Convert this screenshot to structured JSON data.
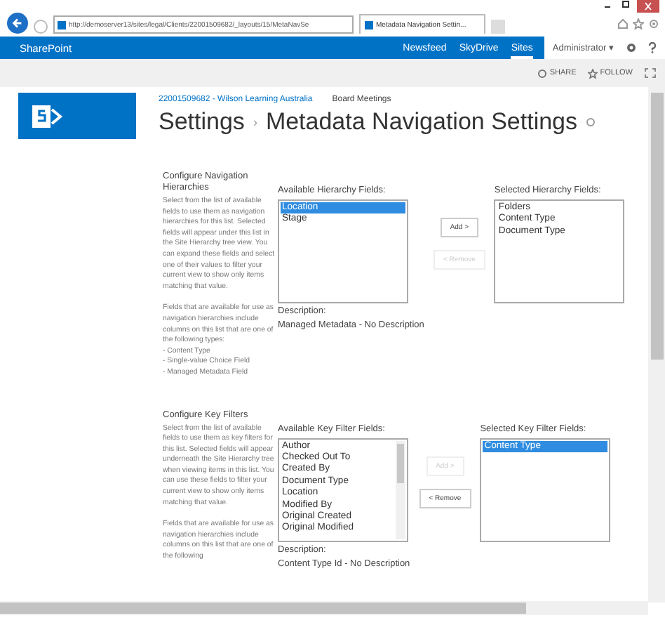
{
  "browser": {
    "address": "http://demoserver13/sites/legal/Clients/22001509682/_layouts/15/MetaNavSe",
    "tab": {
      "title": "Metadata Navigation Settin...",
      "selected": true
    }
  },
  "suite_bar": {
    "brand": "SharePoint",
    "links": [
      {
        "label": "Newsfeed",
        "selected": false
      },
      {
        "label": "SkyDrive",
        "selected": false
      },
      {
        "label": "Sites",
        "selected": true
      }
    ],
    "user": "Administrator",
    "user_caret": "▾"
  },
  "actions": [
    "SHARE",
    "FOLLOW"
  ],
  "breadcrumb": {
    "site": "22001509682 - Wilson Learning Australia",
    "subsite": "Board Meetings"
  },
  "title": {
    "parent": "Settings",
    "separator": "›",
    "page": "Metadata Navigation Settings"
  },
  "sections": [
    {
      "heading": "Configure Navigation Hierarchies",
      "paragraphs": [
        "Select from the list of available fields to use them as navigation hierarchies for this list.  Selected fields will appear under this list in the Site Hierarchy tree view.  You can expand these fields and select one of their values to filter your current view to show only items matching that value.",
        "Fields that are available for use as navigation hierarchies include columns on this list that are one of the following types:\n- Content Type\n- Single-value Choice Field\n- Managed Metadata Field"
      ],
      "available_label": "Available Hierarchy Fields:",
      "available": [
        {
          "label": "Location",
          "selected": true
        },
        {
          "label": "Stage",
          "selected": false
        }
      ],
      "available_scrollbar": false,
      "add": {
        "label": "Add >",
        "disabled": false
      },
      "remove": {
        "label": "< Remove",
        "disabled": true
      },
      "selected_label": "Selected Hierarchy Fields:",
      "chosen": [
        {
          "label": "Folders",
          "selected": false
        },
        {
          "label": "Content Type",
          "selected": false
        },
        {
          "label": "Document Type",
          "selected": false
        }
      ],
      "description_label": "Description:",
      "description": "Managed Metadata - No Description"
    },
    {
      "heading": "Configure Key Filters",
      "paragraphs": [
        "Select from the list of available fields to use them as key filters for this list.  Selected fields will appear underneath the Site Hierarchy tree when viewing items in this list.  You can use these fields to filter your current view to show only items matching that value.",
        "Fields that are available for use as navigation hierarchies include columns on this list that are one of the following"
      ],
      "available_label": "Available Key Filter Fields:",
      "available": [
        {
          "label": "Author",
          "selected": false
        },
        {
          "label": "Checked Out To",
          "selected": false
        },
        {
          "label": "Created By",
          "selected": false
        },
        {
          "label": "Document Type",
          "selected": false
        },
        {
          "label": "Location",
          "selected": false
        },
        {
          "label": "Modified By",
          "selected": false
        },
        {
          "label": "Original Created",
          "selected": false
        },
        {
          "label": "Original Modified",
          "selected": false
        }
      ],
      "available_scrollbar": true,
      "add": {
        "label": "Add >",
        "disabled": true
      },
      "remove": {
        "label": "< Remove",
        "disabled": false
      },
      "selected_label": "Selected Key Filter Fields:",
      "chosen": [
        {
          "label": "Content Type",
          "selected": true
        }
      ],
      "description_label": "Description:",
      "description": "Content Type Id - No Description"
    }
  ]
}
